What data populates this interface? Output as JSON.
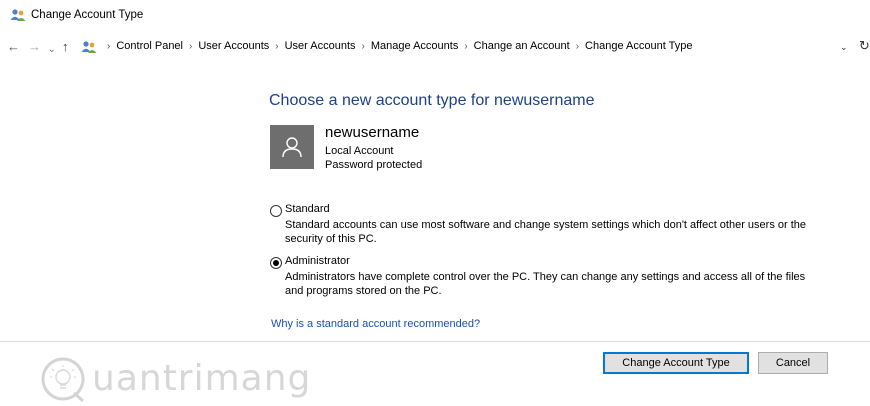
{
  "window": {
    "title": "Change Account Type",
    "icon": "users-icon"
  },
  "address": {
    "breadcrumbs": [
      "Control Panel",
      "User Accounts",
      "User Accounts",
      "Manage Accounts",
      "Change an Account",
      "Change Account Type"
    ],
    "separator": "›"
  },
  "main": {
    "heading": "Choose a new account type for newusername",
    "user": {
      "name": "newusername",
      "type": "Local Account",
      "status": "Password protected"
    },
    "options": [
      {
        "label": "Standard",
        "desc_line1": "Standard accounts can use most software and change system settings which don't affect other users or the",
        "desc_line2": "security of this PC.",
        "selected": false
      },
      {
        "label": "Administrator",
        "desc_line1": "Administrators have complete control over the PC. They can change any settings and access all of the files",
        "desc_line2": "and programs stored on the PC.",
        "selected": true
      }
    ],
    "help_link": "Why is a standard account recommended?"
  },
  "buttons": {
    "change": "Change Account Type",
    "cancel": "Cancel"
  },
  "watermark": {
    "text": "uantrimang"
  },
  "colors": {
    "heading": "#1e3f8a",
    "link": "#1a4fb4",
    "avatar_bg": "#6e6e6e",
    "focus_border": "#0078d7"
  }
}
